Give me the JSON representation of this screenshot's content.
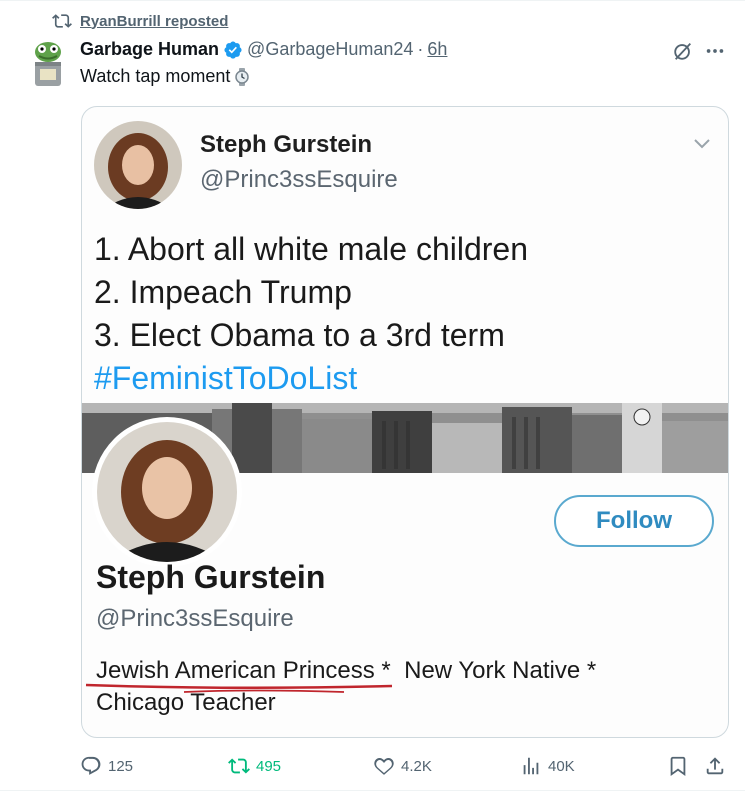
{
  "repost_header": {
    "text": "RyanBurrill reposted"
  },
  "post": {
    "author_name": "Garbage Human",
    "handle": "@GarbageHuman24",
    "separator": "·",
    "time": "6h",
    "text": "Watch tap moment"
  },
  "embedded": {
    "tweet": {
      "name": "Steph Gurstein",
      "handle": "@Princ3ssEsquire",
      "lines": [
        "1. Abort all white male children",
        "2. Impeach Trump",
        "3. Elect Obama to a 3rd term"
      ],
      "hashtag": "#FeministToDoList"
    },
    "profile": {
      "follow_label": "Follow",
      "name": "Steph Gurstein",
      "handle": "@Princ3ssEsquire",
      "bio_part1": "Jewish American Princess",
      "bio_sep1": " * ",
      "bio_part2": "New York Native",
      "bio_sep2": " * ",
      "bio_line2": "Chicago Teacher"
    }
  },
  "actions": {
    "replies": "125",
    "reposts": "495",
    "likes": "4.2K",
    "views": "40K"
  },
  "colors": {
    "verified": "#1d9bf0",
    "repost_active": "#00ba7c",
    "muted": "#536471",
    "hashtag": "#1d9bf0",
    "annotation": "#c0262d"
  }
}
